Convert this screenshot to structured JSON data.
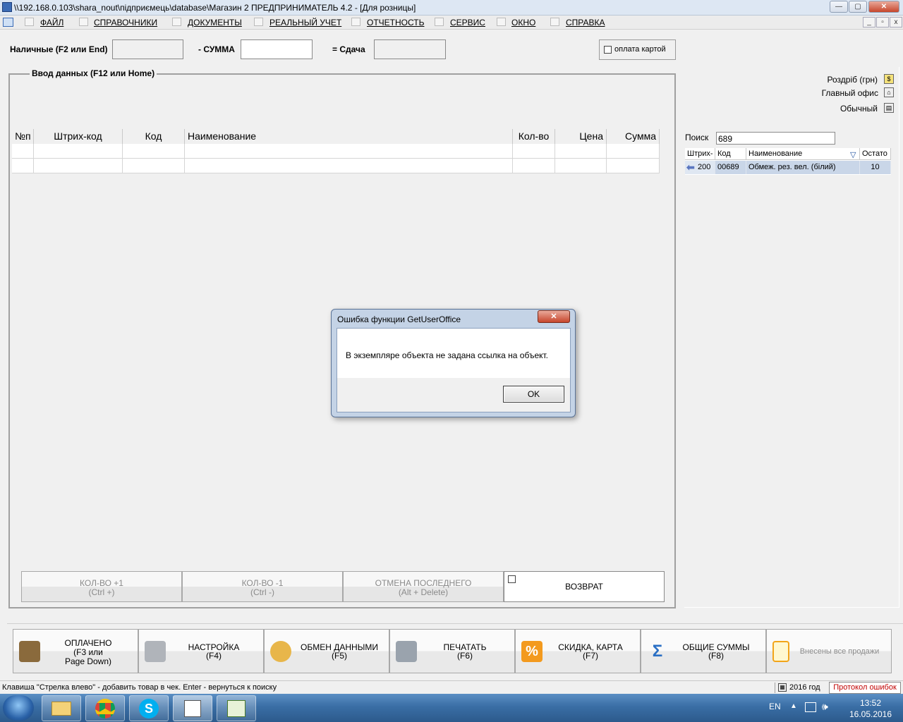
{
  "window": {
    "title": "\\\\192.168.0.103\\shara_nout\\підприємець\\database\\Магазин 2  ПРЕДПРИНИМАТЕЛЬ 4.2 - [Для розницы]",
    "controls": {
      "minimize": "—",
      "maximize": "▢",
      "close": "✕"
    }
  },
  "menu": {
    "items": [
      {
        "label": "ФАЙЛ",
        "icon": "folder-icon"
      },
      {
        "label": "СПРАВОЧНИКИ",
        "icon": "home-icon"
      },
      {
        "label": "ДОКУМЕНТЫ",
        "icon": "document-icon"
      },
      {
        "label": "РЕАЛЬНЫЙ УЧЕТ",
        "icon": "ledger-icon"
      },
      {
        "label": "ОТЧЕТНОСТЬ",
        "icon": "report-icon"
      },
      {
        "label": "СЕРВИС",
        "icon": "service-icon"
      },
      {
        "label": "ОКНО",
        "icon": "window-icon"
      },
      {
        "label": "СПРАВКА",
        "icon": "help-icon"
      }
    ],
    "mdi_controls": {
      "minimize": "_",
      "restore": "▫",
      "close": "x"
    }
  },
  "payment": {
    "cash_label": "Наличные (F2 или End)",
    "cash_value": "",
    "sum_label": "- СУММА",
    "sum_value": "",
    "change_label": "= Сдача",
    "change_value": "",
    "card_label": "оплата картой"
  },
  "entry": {
    "group_title": "Ввод данных (F12 или Home)",
    "columns": [
      "№п",
      "Штрих-код",
      "Код",
      "Наименование",
      "Кол-во",
      "Цена",
      "Сумма"
    ],
    "rows": [
      [
        "",
        "",
        "",
        "",
        "",
        "",
        ""
      ],
      [
        "",
        "",
        "",
        "",
        "",
        "",
        ""
      ]
    ]
  },
  "actions": {
    "qty_plus": {
      "label": "КОЛ-ВО +1",
      "shortcut": "(Ctrl +)"
    },
    "qty_minus": {
      "label": "КОЛ-ВО -1",
      "shortcut": "(Ctrl -)"
    },
    "cancel_last": {
      "label": "ОТМЕНА ПОСЛЕДНЕГО",
      "shortcut": "(Alt + Delete)"
    },
    "return": {
      "label": "ВОЗВРАТ"
    }
  },
  "right_panel": {
    "price_type": "Роздріб (грн)",
    "office": "Главный офис",
    "print_mode": "Обычный",
    "search_label": "Поиск",
    "search_value": "689",
    "columns": [
      "Штрих-",
      "Код",
      "Наименование",
      "Остато"
    ],
    "rows": [
      {
        "barcode": "200",
        "code": "00689",
        "name": "Обмеж. рез. вел. (білий)",
        "rest": "10"
      }
    ]
  },
  "function_buttons": [
    {
      "line1": "ОПЛАЧЕНО",
      "line2": "(F3 или",
      "line3": "Page Down)",
      "icon": "stamp-icon"
    },
    {
      "line1": "НАСТРОЙКА",
      "line2": "(F4)",
      "icon": "tools-icon"
    },
    {
      "line1": "ОБМЕН ДАННЫМИ",
      "line2": "(F5)",
      "icon": "sync-icon"
    },
    {
      "line1": "ПЕЧАТАТЬ",
      "line2": "(F6)",
      "icon": "printer-icon"
    },
    {
      "line1": "СКИДКА, КАРТА",
      "line2": "(F7)",
      "icon": "percent-icon"
    },
    {
      "line1": "ОБЩИЕ СУММЫ",
      "line2": "(F8)",
      "icon": "sigma-icon"
    },
    {
      "line1": "Внесены все продажи",
      "icon": "note-icon"
    }
  ],
  "status": {
    "hint": "Клавиша \"Стрелка влево\" - добавить товар в чек. Enter - вернуться к поиску",
    "year": "2016 год",
    "errors_link": "Протокол ошибок"
  },
  "dialog": {
    "title": "Ошибка функции GetUserOffice",
    "message": "В экземпляре объекта не задана ссылка на объект.",
    "ok": "OK",
    "close": "✕"
  },
  "taskbar": {
    "lang": "EN",
    "time": "13:52",
    "date": "16.05.2016",
    "apps": [
      "explorer-icon",
      "chrome-icon",
      "skype-icon",
      "notes-icon",
      "shop-app-icon"
    ]
  }
}
